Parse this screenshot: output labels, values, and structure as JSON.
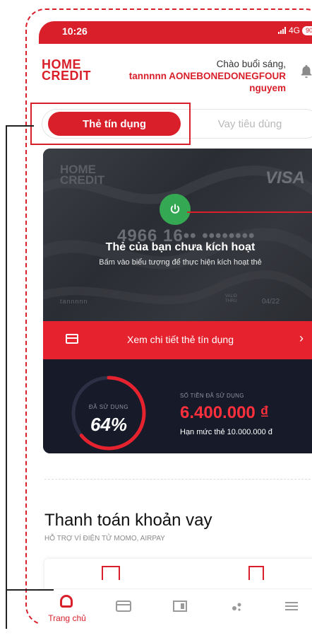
{
  "status_bar": {
    "time": "10:26",
    "network": "4G",
    "battery": "90"
  },
  "header": {
    "logo_line1": "HOME",
    "logo_line2": "CREDIT",
    "greeting": "Chào buổi sáng,",
    "user_name": "tannnnn AONEBONEDONEGFOUR nguyem",
    "bell_icon": "bell-icon"
  },
  "tabs": [
    {
      "label": "Thẻ tín dụng",
      "active": true
    },
    {
      "label": "Vay tiêu dùng",
      "active": false
    }
  ],
  "card": {
    "brand_line1": "HOME",
    "brand_line2": "CREDIT",
    "network": "VISA",
    "number": "4966 16•• ••••••••",
    "title": "Thẻ của bạn chưa kích hoạt",
    "subtitle": "Bấm vào biểu tượng để thực hiện kích hoạt thẻ",
    "holder": "tannnnn",
    "valid_label_1": "VALID",
    "valid_label_2": "THRU",
    "expiry": "04/22",
    "power_icon": "power-icon"
  },
  "detail_bar": {
    "label": "Xem chi tiết thẻ tín dụng"
  },
  "usage": {
    "used_label": "ĐÃ SỬ DỤNG",
    "used_percent_text": "64%",
    "used_fraction": 0.64,
    "amount_label": "SỐ TIỀN ĐÃ SỬ DỤNG",
    "amount_value": "6.400.000 ₫",
    "limit_text": "Hạn mức thẻ 10.000.000 đ"
  },
  "payment_section": {
    "title": "Thanh toán khoản vay",
    "subtitle": "HỖ TRỢ VÍ ĐIỆN TỬ MOMO, AIRPAY"
  },
  "bottom_nav": {
    "home_label": "Trang chủ",
    "items": [
      "card-icon",
      "book-icon",
      "dots-icon",
      "menu-icon"
    ]
  },
  "colors": {
    "brand_red": "#d81f2a",
    "activate_green": "#35a853",
    "usage_bg": "#161a29",
    "gauge_track": "#2b3044"
  }
}
